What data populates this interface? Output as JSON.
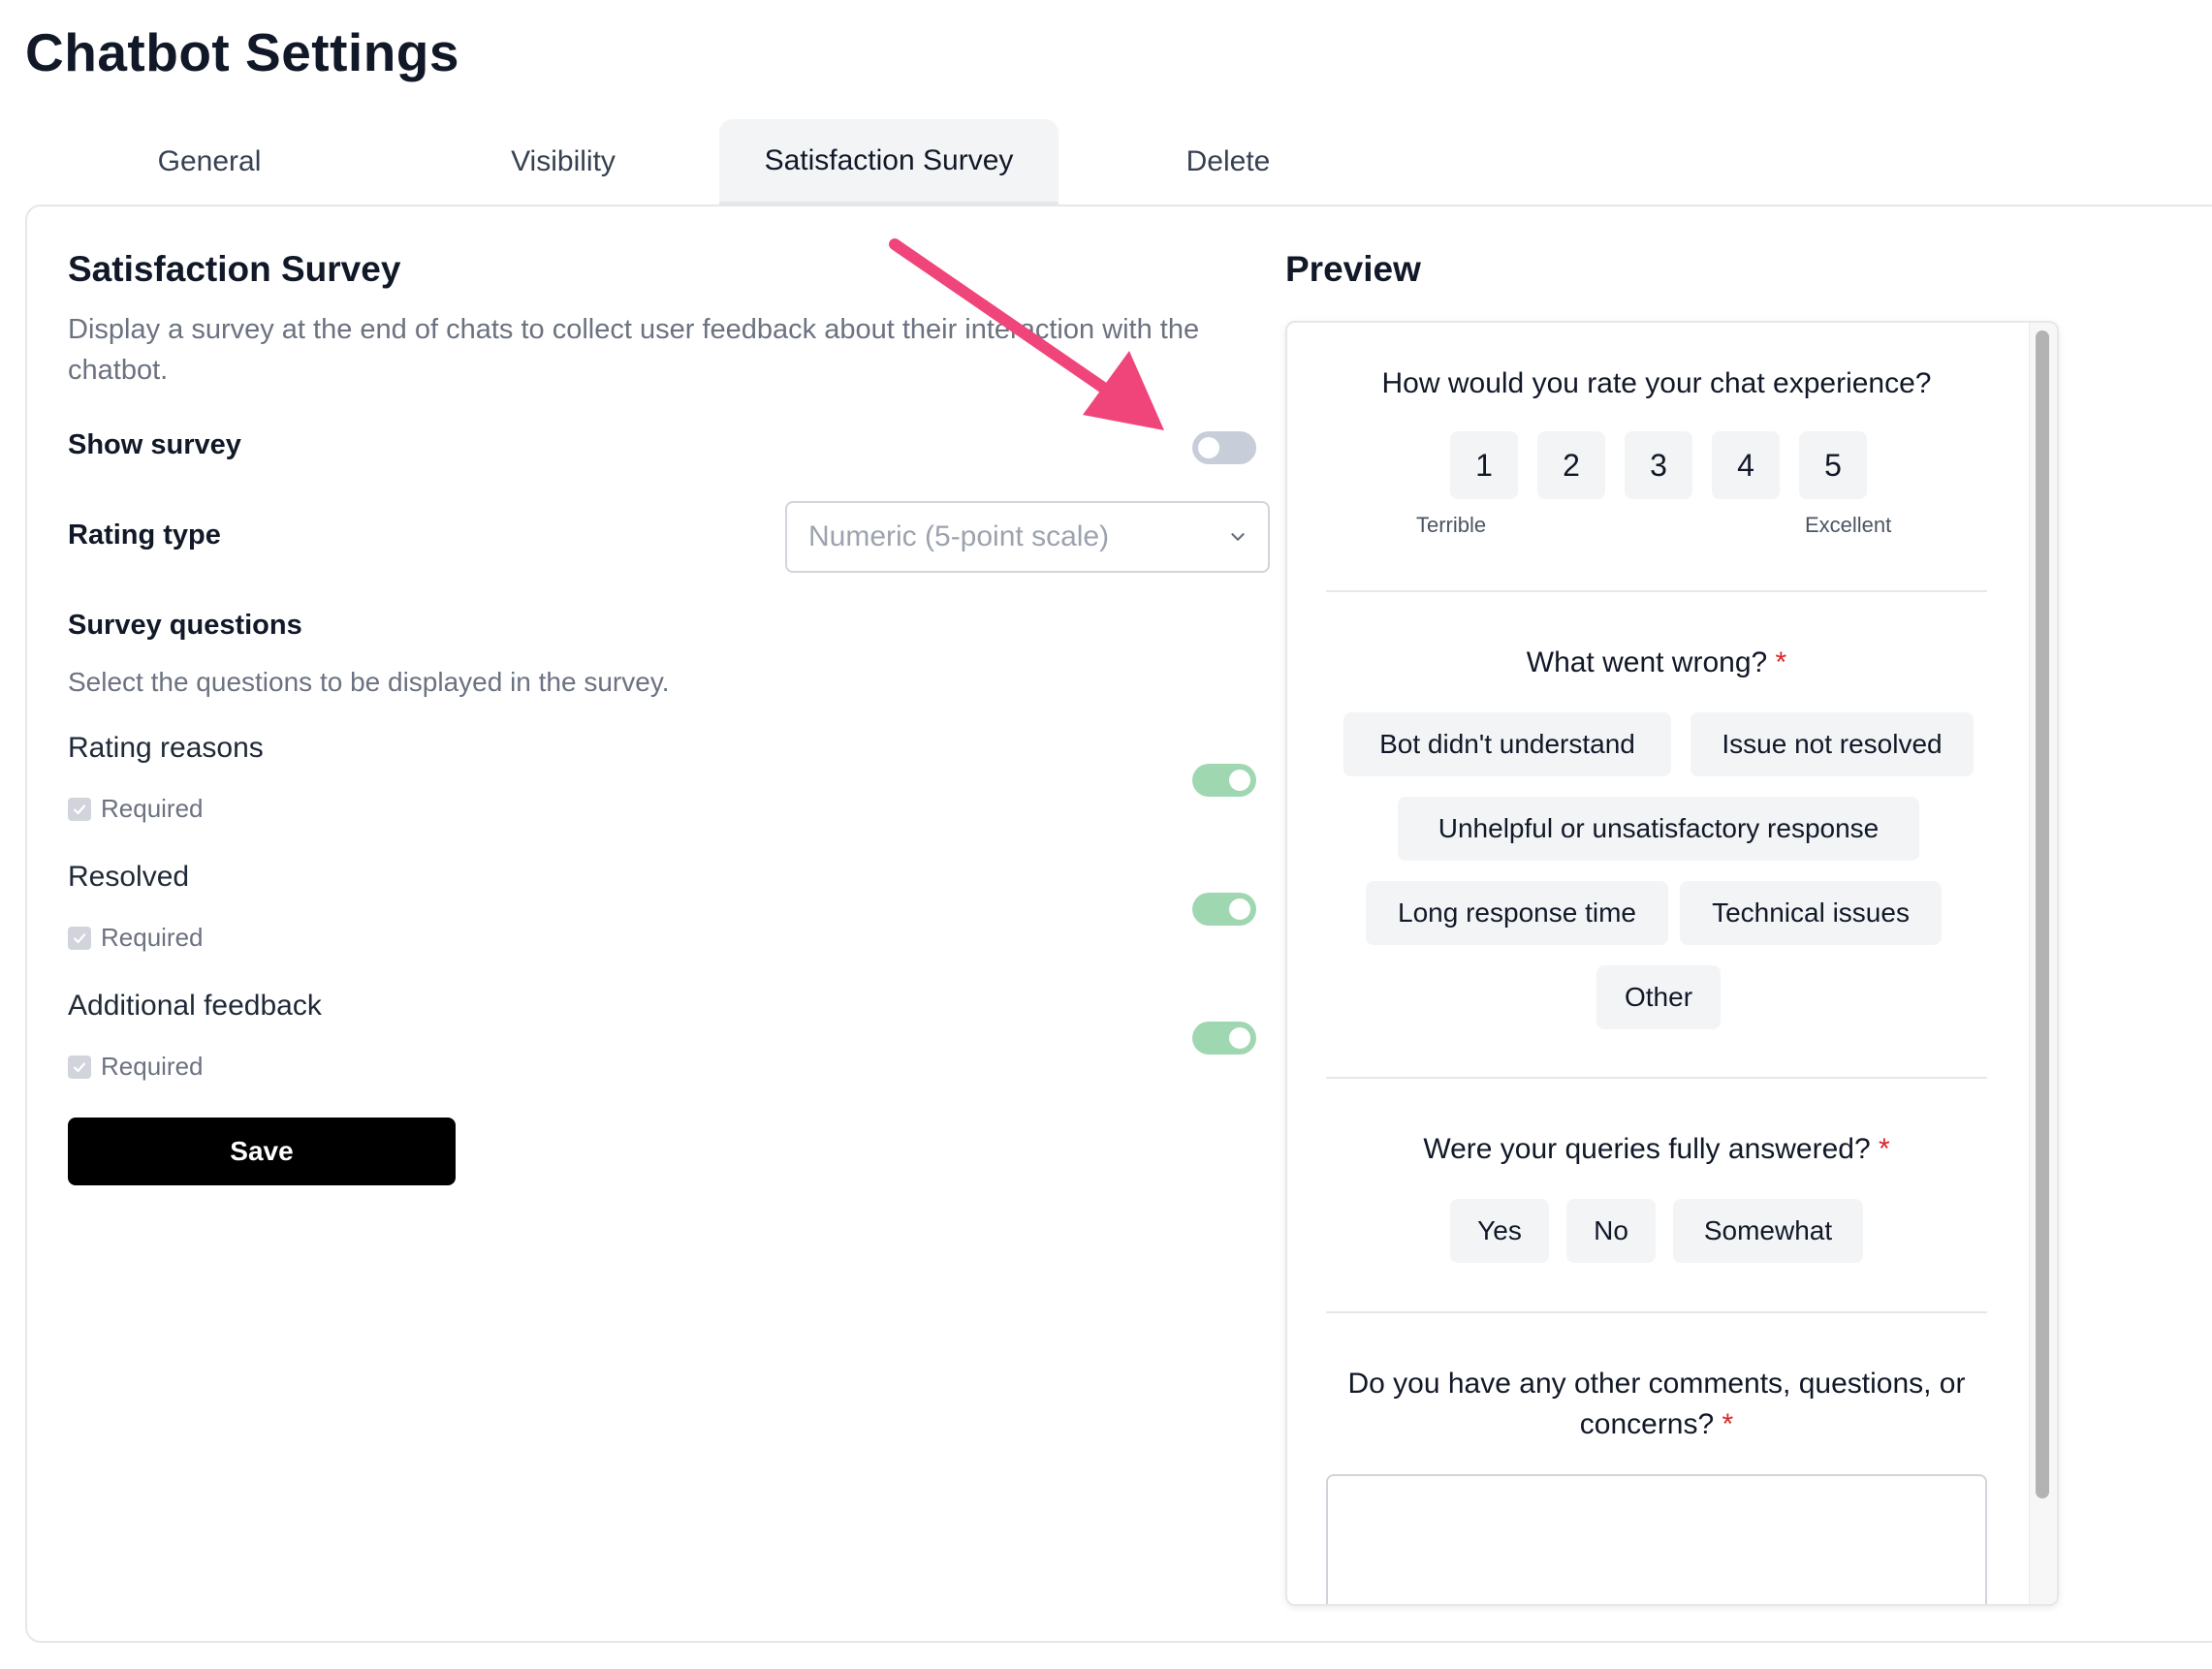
{
  "page_title": "Chatbot Settings",
  "tabs": [
    {
      "label": "General"
    },
    {
      "label": "Visibility"
    },
    {
      "label": "Satisfaction Survey"
    },
    {
      "label": "Delete"
    }
  ],
  "active_tab": "Satisfaction Survey",
  "settings": {
    "title": "Satisfaction Survey",
    "description": "Display a survey at the end of chats to collect user feedback about their interaction with the chatbot.",
    "show_survey_label": "Show survey",
    "show_survey_on": false,
    "rating_type_label": "Rating type",
    "rating_type_value": "Numeric (5-point scale)",
    "questions_title": "Survey questions",
    "questions_desc": "Select the questions to be displayed in the survey.",
    "questions": [
      {
        "label": "Rating reasons",
        "required_label": "Required",
        "required": true,
        "enabled": true
      },
      {
        "label": "Resolved",
        "required_label": "Required",
        "required": true,
        "enabled": true
      },
      {
        "label": "Additional feedback",
        "required_label": "Required",
        "required": true,
        "enabled": true
      }
    ],
    "save_label": "Save"
  },
  "preview": {
    "title": "Preview",
    "rating_question": "How would you rate your chat experience?",
    "rating_options": [
      "1",
      "2",
      "3",
      "4",
      "5"
    ],
    "low_label": "Terrible",
    "high_label": "Excellent",
    "reasons_question": "What went wrong?",
    "reasons": [
      "Bot didn't understand",
      "Issue not resolved",
      "Unhelpful or unsatisfactory response",
      "Long response time",
      "Technical issues",
      "Other"
    ],
    "resolved_question": "Were your queries fully answered?",
    "resolved_options": [
      "Yes",
      "No",
      "Somewhat"
    ],
    "feedback_question": "Do you have any other comments, questions, or concerns?",
    "required_marker": "*"
  },
  "colors": {
    "toggle_off": "#c7cdd9",
    "toggle_on": "#9fd7b1",
    "annotation_arrow": "#f0457a",
    "required_star": "#dc2626"
  }
}
